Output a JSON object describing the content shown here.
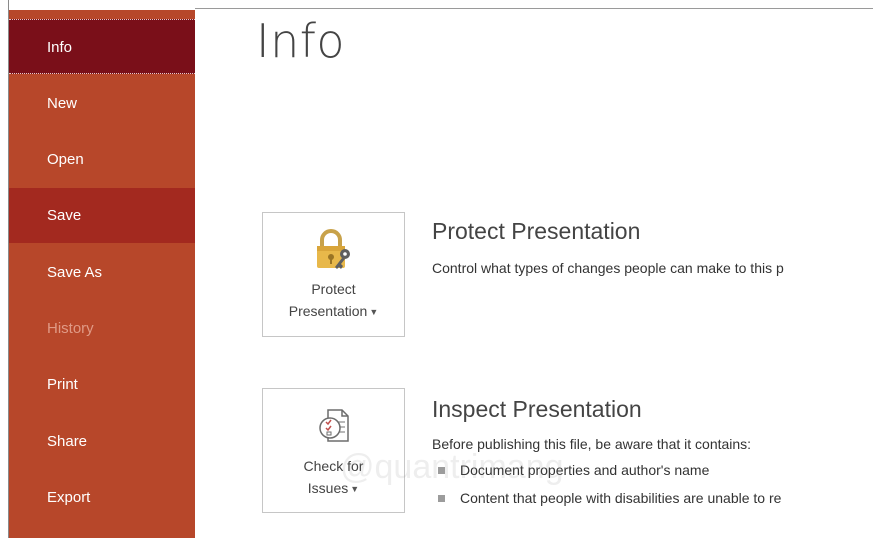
{
  "nav": {
    "items": [
      {
        "label": "Info"
      },
      {
        "label": "New"
      },
      {
        "label": "Open"
      },
      {
        "label": "Save"
      },
      {
        "label": "Save As"
      },
      {
        "label": "History"
      },
      {
        "label": "Print"
      },
      {
        "label": "Share"
      },
      {
        "label": "Export"
      }
    ],
    "selected": "Info",
    "hovered": "Save",
    "disabled": [
      "History"
    ],
    "colors": {
      "background": "#b7472a",
      "selected": "#7a0f19",
      "hover": "#a3291f"
    }
  },
  "page": {
    "title": "Info"
  },
  "protect": {
    "button_line1": "Protect",
    "button_line2": "Presentation",
    "icon": "lock-key-icon",
    "title": "Protect Presentation",
    "description": "Control what types of changes people can make to this p"
  },
  "inspect": {
    "button_line1": "Check for",
    "button_line2": "Issues",
    "icon": "inspect-document-icon",
    "title": "Inspect Presentation",
    "description": "Before publishing this file, be aware that it contains:",
    "bullets": [
      "Document properties and author's name",
      "Content that people with disabilities are unable to re"
    ]
  },
  "watermark": "@quantrimang"
}
